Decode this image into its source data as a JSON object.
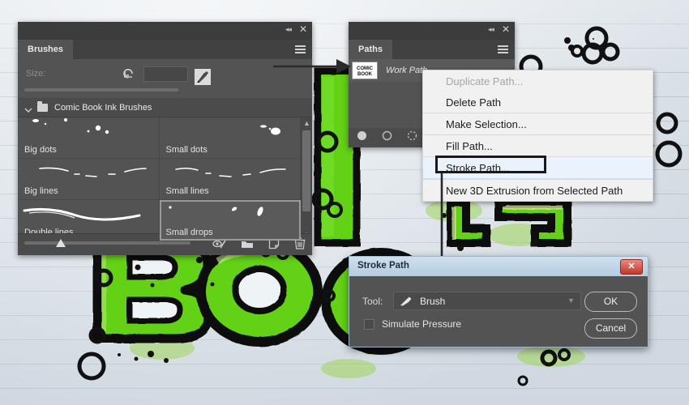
{
  "brushes_panel": {
    "tab_label": "Brushes",
    "size_label": "Size:",
    "size_value": "",
    "group_label": "Comic Book Ink Brushes",
    "icons": {
      "collapse": "double-chevron-left-icon",
      "close": "close-icon",
      "menu": "panel-menu-icon",
      "reset": "reset-icon",
      "brush_tip": "brush-tip-icon",
      "toggle_brush": "toggle-brush-icon",
      "new_group": "new-group-icon",
      "new_brush": "new-brush-icon",
      "delete_brush": "delete-brush-icon"
    },
    "brushes": [
      {
        "name": "Big dots",
        "selected": false
      },
      {
        "name": "Small dots",
        "selected": false
      },
      {
        "name": "Big lines",
        "selected": false
      },
      {
        "name": "Small lines",
        "selected": false
      },
      {
        "name": "Double lines",
        "selected": false
      },
      {
        "name": "Small drops",
        "selected": true
      }
    ]
  },
  "paths_panel": {
    "tab_label": "Paths",
    "path_name": "Work Path",
    "thumbnail_text": "COMIC BOOK",
    "icons": {
      "collapse": "double-chevron-left-icon",
      "close": "close-icon",
      "menu": "panel-menu-icon",
      "fill_path": "fill-path-icon",
      "stroke_path": "stroke-path-icon",
      "load_selection": "load-selection-icon"
    }
  },
  "context_menu": {
    "items": [
      {
        "label": "Duplicate Path...",
        "disabled": true,
        "separator": false,
        "highlight": false
      },
      {
        "label": "Delete Path",
        "disabled": false,
        "separator": false,
        "highlight": false
      },
      {
        "label": "Make Selection...",
        "disabled": false,
        "separator": true,
        "highlight": false
      },
      {
        "label": "Fill Path...",
        "disabled": false,
        "separator": true,
        "highlight": false
      },
      {
        "label": "Stroke Path...",
        "disabled": false,
        "separator": false,
        "highlight": true
      },
      {
        "label": "New 3D Extrusion from Selected Path",
        "disabled": false,
        "separator": true,
        "highlight": false
      }
    ]
  },
  "stroke_dialog": {
    "title": "Stroke Path",
    "close_label": "✕",
    "tool_label": "Tool:",
    "tool_value": "Brush",
    "tool_icon": "paintbrush-icon",
    "simulate_pressure_label": "Simulate Pressure",
    "simulate_pressure_checked": false,
    "ok_label": "OK",
    "cancel_label": "Cancel"
  },
  "artwork": {
    "letters": "BO",
    "green": "#63d118",
    "outline": "#111111"
  },
  "annotations": {
    "horizontal_arrow": "arrow-pointing-right-to-paths-panel",
    "vertical_arrow": "arrow-pointing-down-to-stroke-dialog"
  }
}
